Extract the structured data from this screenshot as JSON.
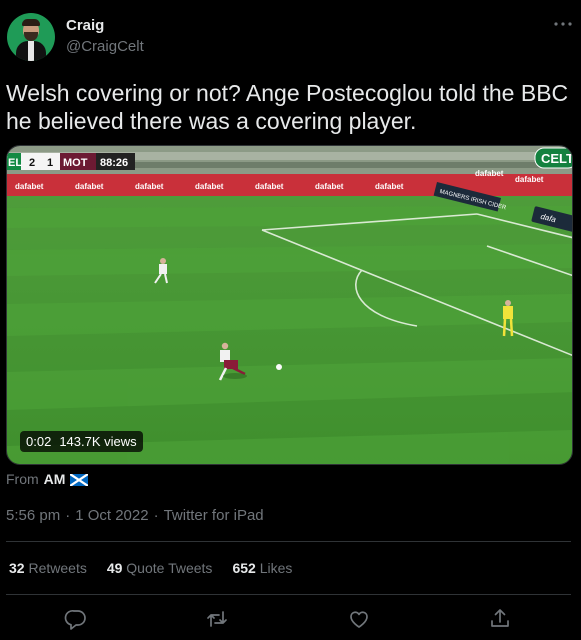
{
  "author": {
    "name": "Craig",
    "handle": "@CraigCelt"
  },
  "more_icon": "more-horizontal-icon",
  "tweet_text": "Welsh covering or not? Ange Postecoglou told the BBC he believed there was a covering player.",
  "media": {
    "scoreboard": {
      "home": "EL",
      "home_score": "2",
      "away_score": "1",
      "away": "MOT",
      "clock": "88:26"
    },
    "badge": "CELT",
    "ad_boards": [
      "dafabet",
      "dafabet",
      "dafabet",
      "dafabet",
      "dafabet",
      "dafabet",
      "dafabet",
      "dafabet",
      "dafabet"
    ],
    "hoarding": "MAGNERS IRISH CIDER",
    "corner_ad": "dafa",
    "video_time": "0:02",
    "views": "143.7K views",
    "colors": {
      "pitch_light": "#4fa53a",
      "pitch_dark": "#3f9230"
    }
  },
  "source": {
    "prefix": "From",
    "name": "AM",
    "flag": "scotland-flag-icon"
  },
  "meta": {
    "time": "5:56 pm",
    "separator": "·",
    "date": "1 Oct 2022",
    "client": "Twitter for iPad"
  },
  "stats": {
    "retweets_count": "32",
    "retweets_label": "Retweets",
    "quotes_count": "49",
    "quotes_label": "Quote Tweets",
    "likes_count": "652",
    "likes_label": "Likes"
  },
  "actions": [
    "reply-icon",
    "retweet-icon",
    "like-icon",
    "share-icon"
  ],
  "colors": {
    "background": "#000000",
    "text": "#e7e9ea",
    "muted": "#71767b",
    "border": "#2f3336"
  }
}
